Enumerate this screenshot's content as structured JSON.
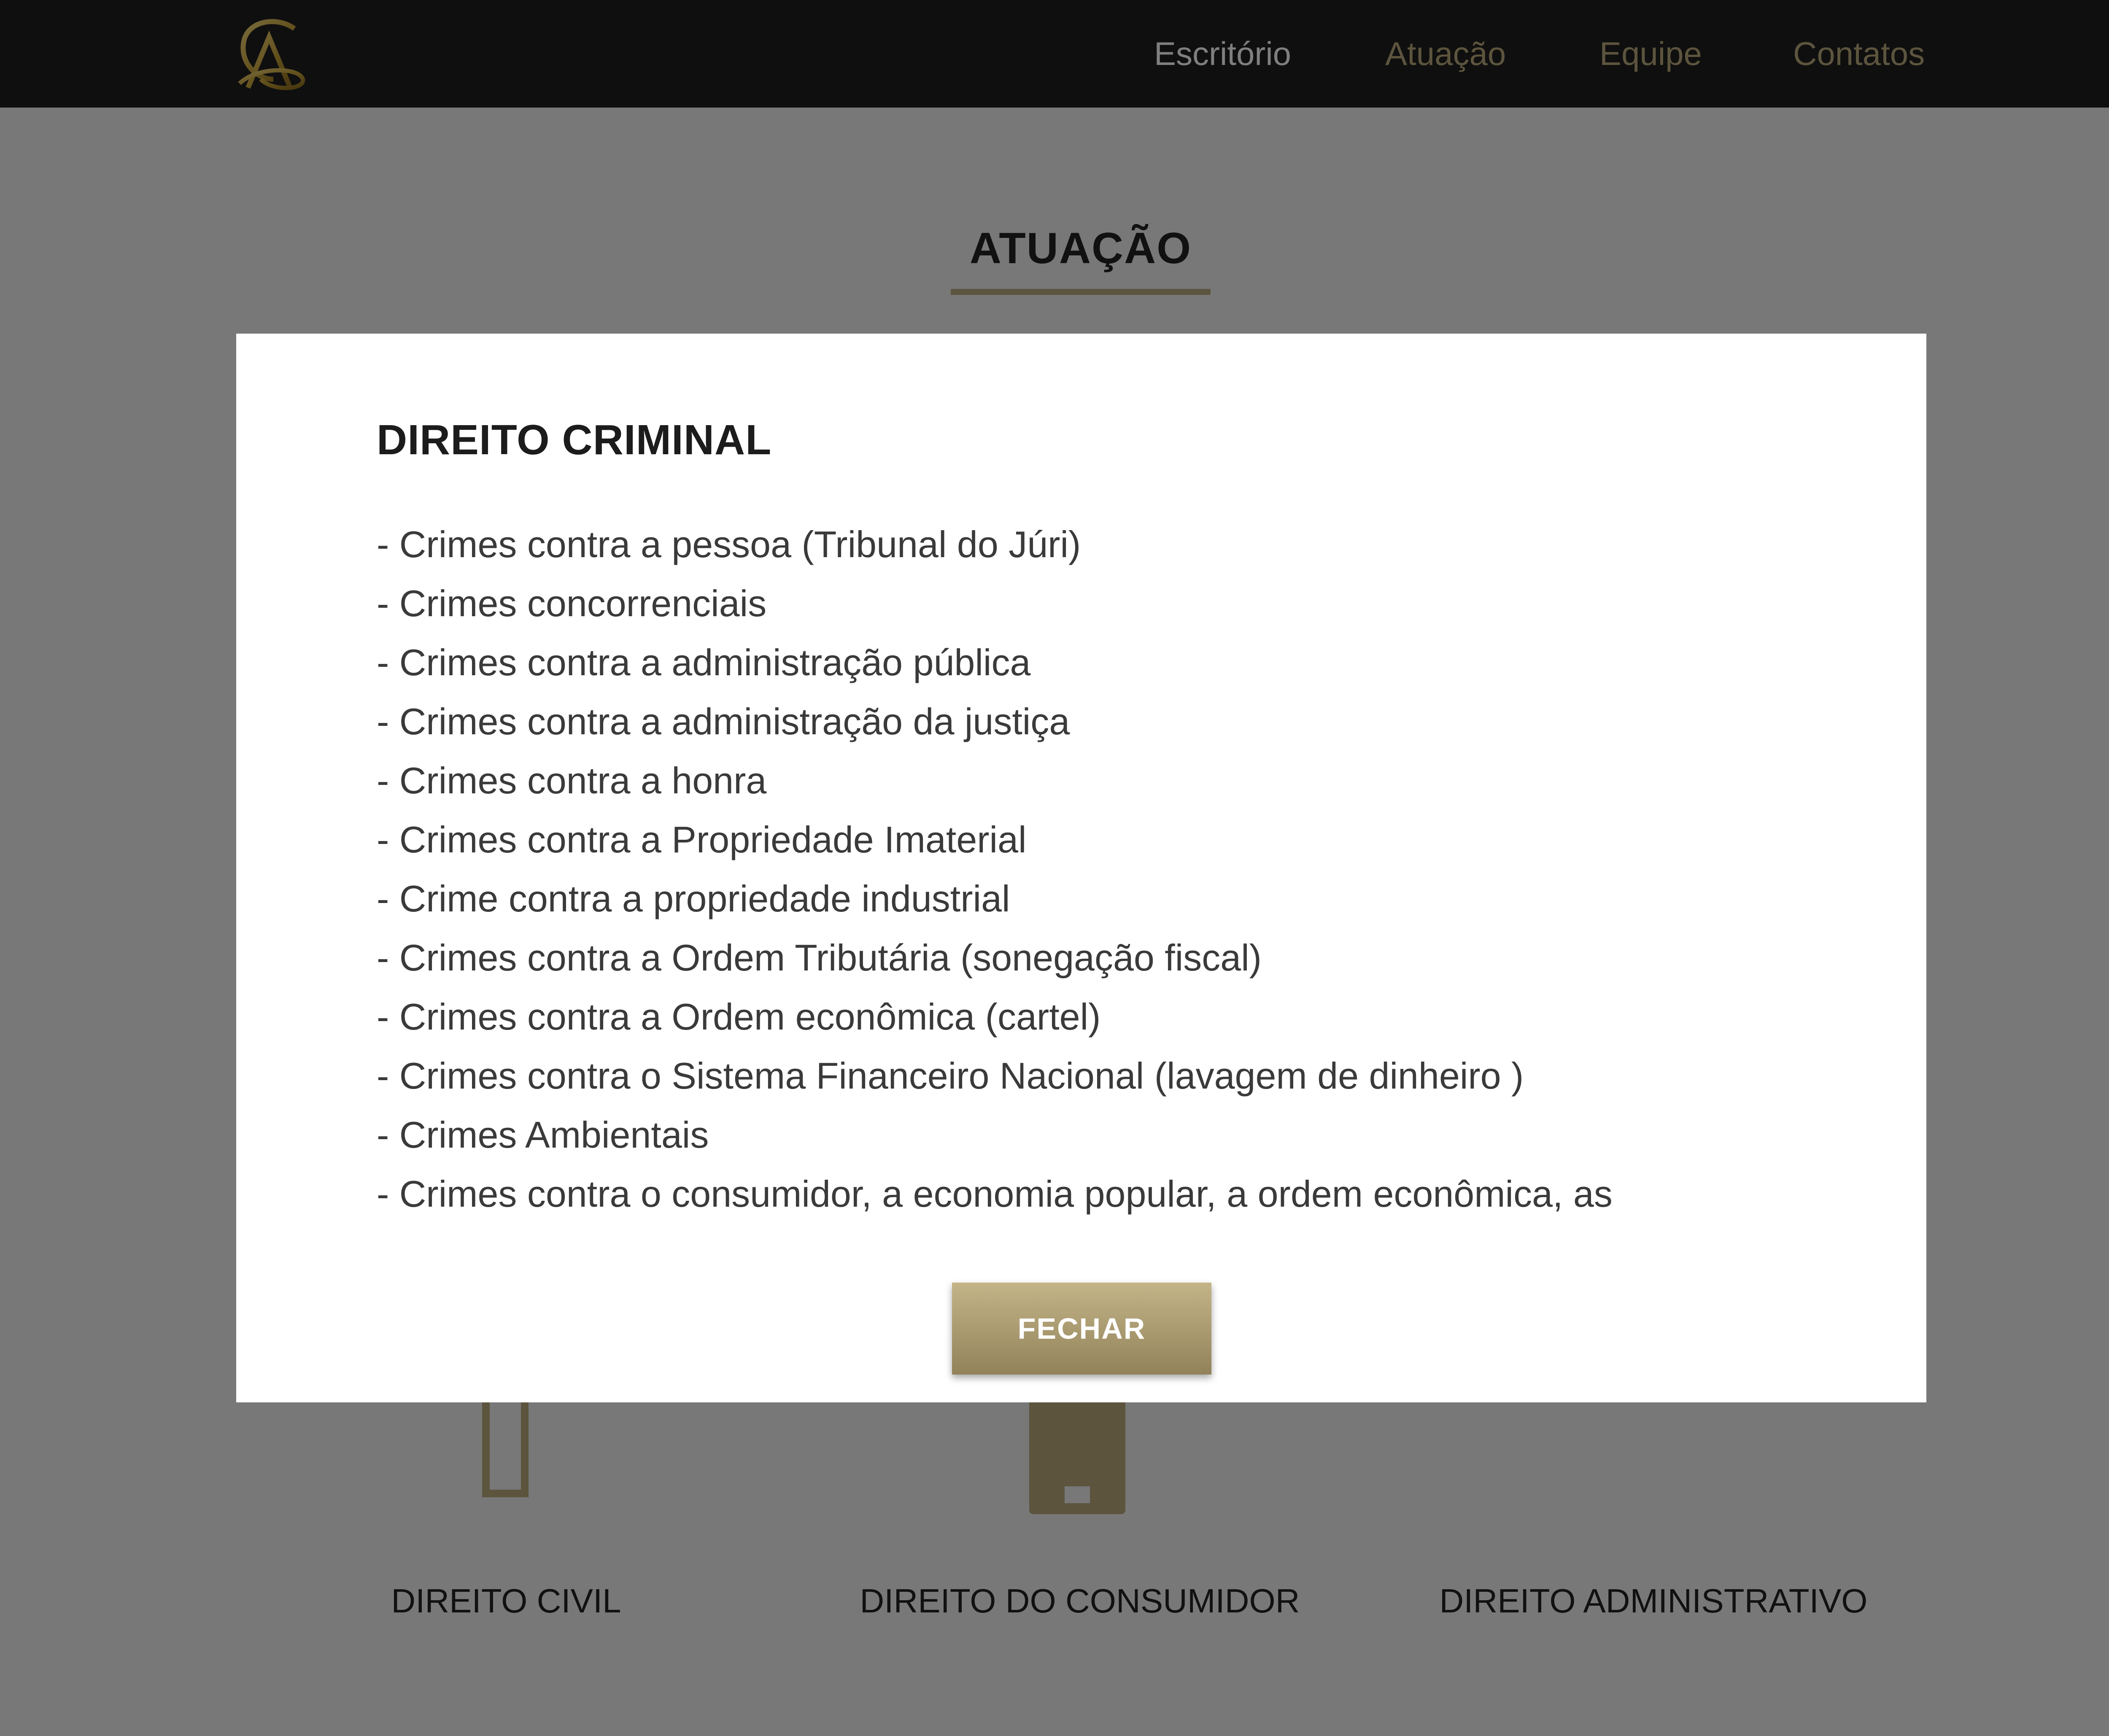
{
  "header": {
    "nav": [
      "Escritório",
      "Atuação",
      "Equipe",
      "Contatos"
    ],
    "colors": {
      "bar": "#1f1f1f",
      "accent": "#b9a97a",
      "active": "#ffffff"
    }
  },
  "section": {
    "title": "ATUAÇÃO",
    "areas": [
      {
        "label": "DIREITO CIVIL",
        "icon": "scale-icon"
      },
      {
        "label": "DIREITO DO CONSUMIDOR",
        "icon": "building-icon"
      },
      {
        "label": "DIREITO ADMINISTRATIVO",
        "icon": ""
      }
    ]
  },
  "modal": {
    "title": "DIREITO CRIMINAL",
    "items": [
      "- Crimes contra a pessoa (Tribunal do Júri)",
      "- Crimes concorrenciais",
      "- Crimes contra a administração pública",
      "- Crimes contra a administração da justiça",
      "- Crimes contra a honra",
      "- Crimes contra a Propriedade Imaterial",
      "- Crime contra a propriedade industrial",
      "- Crimes contra a Ordem Tributária (sonegação fiscal)",
      "- Crimes contra a Ordem econômica (cartel)",
      "- Crimes contra o Sistema Financeiro Nacional (lavagem de dinheiro )",
      "- Crimes Ambientais",
      "- Crimes contra o consumidor, a economia popular, a ordem econômica, as"
    ],
    "close_label": "FECHAR"
  }
}
